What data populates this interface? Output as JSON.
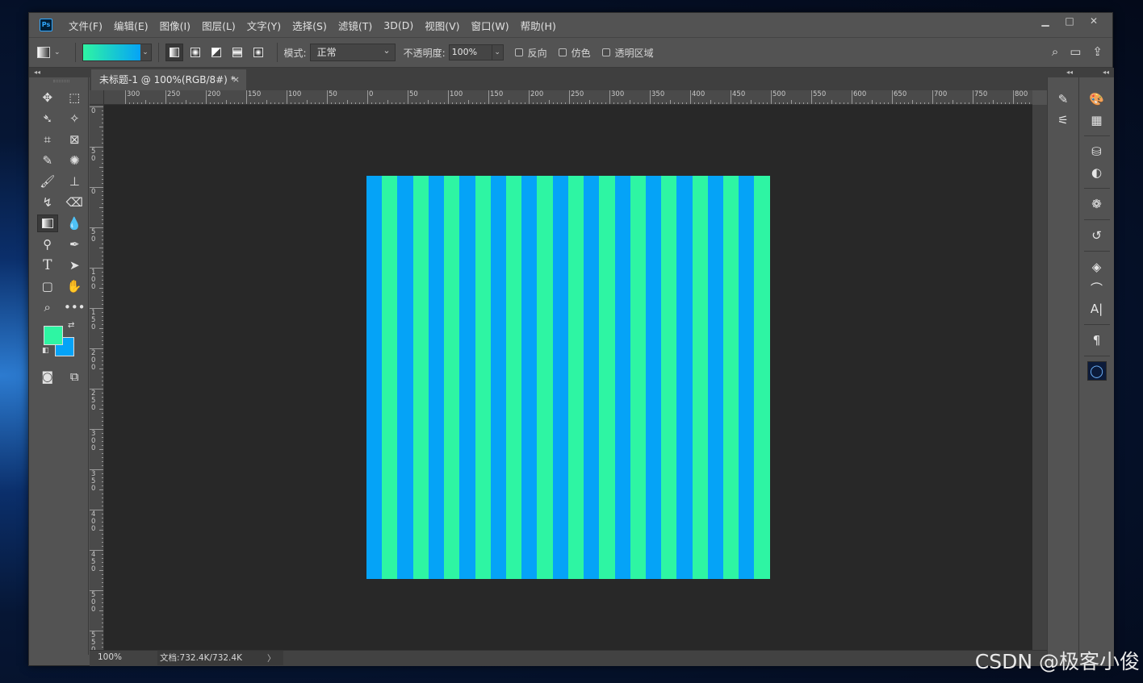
{
  "app": {
    "logo": "Ps"
  },
  "menu": [
    "文件(F)",
    "编辑(E)",
    "图像(I)",
    "图层(L)",
    "文字(Y)",
    "选择(S)",
    "滤镜(T)",
    "3D(D)",
    "视图(V)",
    "窗口(W)",
    "帮助(H)"
  ],
  "window_controls": {
    "minimize": "▁",
    "maximize": "□",
    "close": "✕"
  },
  "options": {
    "mode_label": "模式:",
    "mode_value": "正常",
    "opacity_label": "不透明度:",
    "opacity_value": "100%",
    "reverse_label": "反向",
    "dither_label": "仿色",
    "transparency_label": "透明区域",
    "gradient_colors": [
      "#2ef5a3",
      "#05a3f7"
    ]
  },
  "document": {
    "tab_title": "未标题-1 @ 100%(RGB/8#) *",
    "tab_close": "×",
    "zoom": "100%",
    "doc_info": "文档:732.4K/732.4K",
    "status_arrow": "〉"
  },
  "ruler": {
    "top_labels": [
      "300",
      "250",
      "200",
      "150",
      "100",
      "50",
      "0",
      "50",
      "100",
      "150",
      "200",
      "250",
      "300",
      "350",
      "400",
      "450",
      "500",
      "550",
      "600",
      "650",
      "700",
      "750",
      "800"
    ],
    "left_labels": [
      "0",
      "50",
      "0",
      "50",
      "100",
      "150",
      "200",
      "250",
      "300",
      "350",
      "400",
      "450",
      "500",
      "550"
    ]
  },
  "canvas": {
    "stripe_colors": [
      "#05a3f7",
      "#2ef5a3"
    ],
    "stripe_count": 26
  },
  "colors": {
    "foreground": "#2ef5a3",
    "background": "#05a3f7"
  },
  "watermark": "CSDN @极客小俊"
}
